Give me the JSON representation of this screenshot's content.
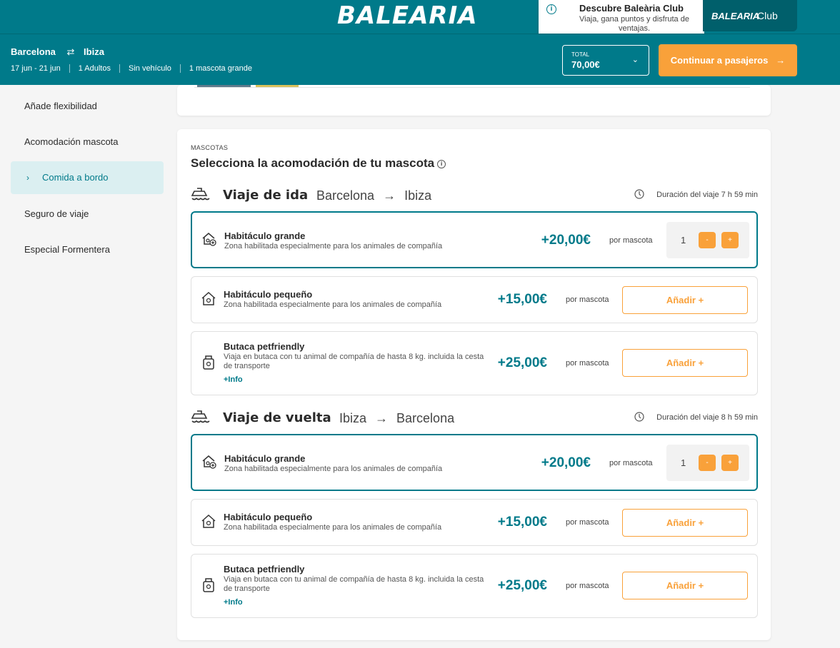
{
  "header": {
    "logo_text": "BALEARIA",
    "club_popup": {
      "title": "Descubre Baleària Club",
      "subtitle": "Viaja, gana puntos y disfruta de ventajas."
    },
    "club_button": {
      "brand": "BALEARIA",
      "label": "Club"
    }
  },
  "trip": {
    "origin": "Barcelona",
    "destination": "Ibiza",
    "dates": "17 jun - 21 jun",
    "adults": "1 Adultos",
    "vehicle": "Sin vehículo",
    "pets": "1 mascota grande",
    "total_label": "TOTAL",
    "total_value": "70,00€",
    "continue_label": "Continuar a pasajeros"
  },
  "sidebar": {
    "items": [
      {
        "label": "Añade flexibilidad"
      },
      {
        "label": "Acomodación mascota"
      },
      {
        "label": "Comida a bordo",
        "active": true
      },
      {
        "label": "Seguro de viaje"
      },
      {
        "label": "Especial Formentera"
      }
    ]
  },
  "pets_section": {
    "label": "MASCOTAS",
    "title": "Selecciona la acomodación de tu mascota",
    "per_label": "por mascota",
    "add_label": "Añadir +",
    "more_info": "+Info",
    "outbound": {
      "title": "Viaje de ida",
      "from": "Barcelona",
      "to": "Ibiza",
      "duration": "Duración del viaje 7 h 59 min",
      "options": [
        {
          "name": "Habitáculo grande",
          "desc": "Zona habilitada especialmente para los animales de compañía",
          "price": "+20,00€",
          "qty": "1"
        },
        {
          "name": "Habitáculo pequeño",
          "desc": "Zona habilitada especialmente para los animales de compañía",
          "price": "+15,00€"
        },
        {
          "name": "Butaca petfriendly",
          "desc": "Viaja en butaca con tu animal de compañía de hasta 8 kg. incluida la cesta de transporte",
          "price": "+25,00€"
        }
      ]
    },
    "return": {
      "title": "Viaje de vuelta",
      "from": "Ibiza",
      "to": "Barcelona",
      "duration": "Duración del viaje 8 h 59 min",
      "options": [
        {
          "name": "Habitáculo grande",
          "desc": "Zona habilitada especialmente para los animales de compañía",
          "price": "+20,00€",
          "qty": "1"
        },
        {
          "name": "Habitáculo pequeño",
          "desc": "Zona habilitada especialmente para los animales de compañía",
          "price": "+15,00€"
        },
        {
          "name": "Butaca petfriendly",
          "desc": "Viaja en butaca con tu animal de compañía de hasta 8 kg. incluida la cesta de transporte",
          "price": "+25,00€"
        }
      ]
    }
  },
  "colors": {
    "brand": "#007a8a",
    "accent": "#f9a13a",
    "active_bg": "#dbeff1"
  }
}
